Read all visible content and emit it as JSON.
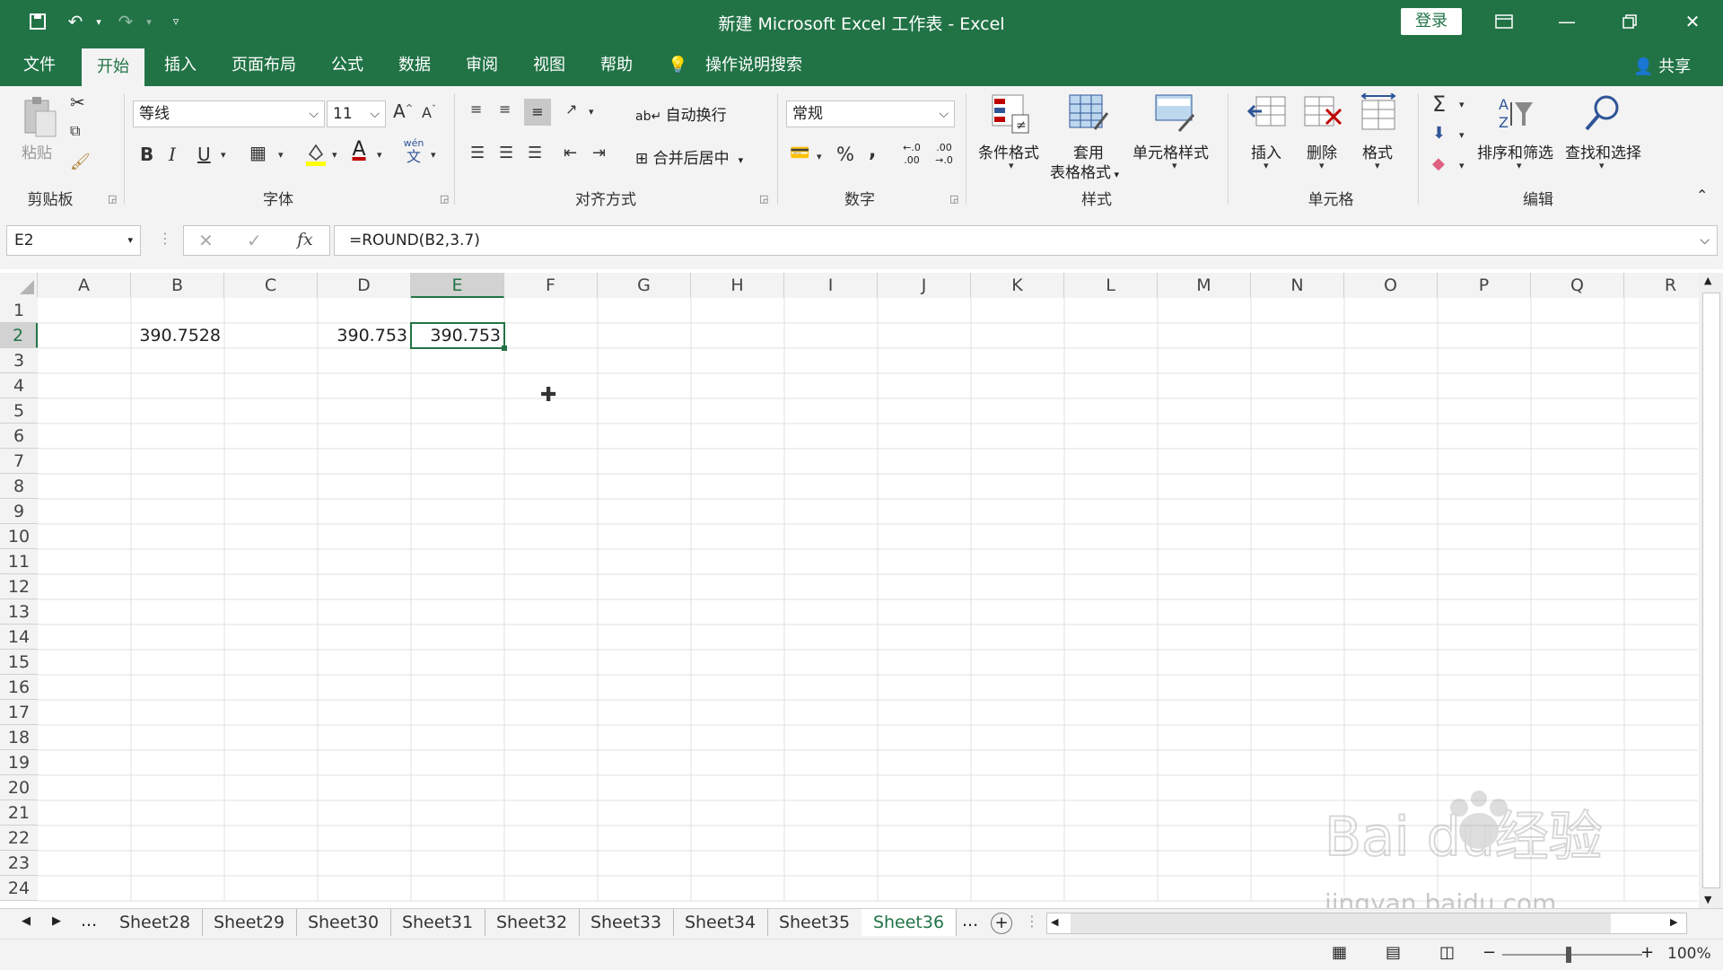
{
  "title_bar": {
    "doc_title": "新建 Microsoft Excel 工作表 - Excel",
    "login": "登录"
  },
  "tabs": [
    "文件",
    "开始",
    "插入",
    "页面布局",
    "公式",
    "数据",
    "审阅",
    "视图",
    "帮助",
    "操作说明搜索"
  ],
  "share": "共享",
  "ribbon": {
    "clipboard": {
      "paste": "粘贴",
      "label": "剪贴板"
    },
    "font": {
      "name": "等线",
      "size": "11",
      "bold": "B",
      "italic": "I",
      "underline": "U",
      "grow": "A",
      "shrink": "A",
      "font_color": "A",
      "phonetic_top": "wén",
      "phonetic_bottom": "文",
      "label": "字体"
    },
    "alignment": {
      "wrap": "自动换行",
      "merge": "合并后居中",
      "label": "对齐方式"
    },
    "number": {
      "format": "常规",
      "percent": "%",
      "comma": ",",
      "inc_dec_top": "←.0",
      "inc_dec_bottom": ".00",
      "dec_dec_top": ".00",
      "dec_dec_bottom": "→.0",
      "label": "数字"
    },
    "styles": {
      "conditional": "条件格式",
      "table_top": "套用",
      "table_bottom": "表格格式",
      "cell_styles": "单元格样式",
      "label": "样式"
    },
    "cells": {
      "insert": "插入",
      "delete": "删除",
      "format": "格式",
      "label": "单元格"
    },
    "editing": {
      "sort": "排序和筛选",
      "find": "查找和选择",
      "label": "编辑"
    }
  },
  "formula_bar": {
    "name_box": "E2",
    "fx": "fx",
    "formula": "=ROUND(B2,3.7)"
  },
  "columns": [
    "A",
    "B",
    "C",
    "D",
    "E",
    "F",
    "G",
    "H",
    "I",
    "J",
    "K",
    "L",
    "M",
    "N",
    "O",
    "P",
    "Q",
    "R"
  ],
  "rows": [
    "1",
    "2",
    "3",
    "4",
    "5",
    "6",
    "7",
    "8",
    "9",
    "10",
    "11",
    "12",
    "13",
    "14",
    "15",
    "16",
    "17",
    "18",
    "19",
    "20",
    "21",
    "22",
    "23",
    "24"
  ],
  "cells": {
    "B2": "390.7528",
    "D2": "390.753",
    "E2": "390.753"
  },
  "sheets": [
    "Sheet28",
    "Sheet29",
    "Sheet30",
    "Sheet31",
    "Sheet32",
    "Sheet33",
    "Sheet34",
    "Sheet35",
    "Sheet36"
  ],
  "sheet_nav": {
    "more_left": "...",
    "more_right": "...",
    "add": "+"
  },
  "status": {
    "zoom": "100%"
  },
  "watermark": {
    "logo": "Baidu经验",
    "url": "jingyan.baidu.com"
  },
  "colors": {
    "accent": "#217346",
    "ribbon": "#f3f3f3",
    "grid": "#e1e1e1"
  }
}
